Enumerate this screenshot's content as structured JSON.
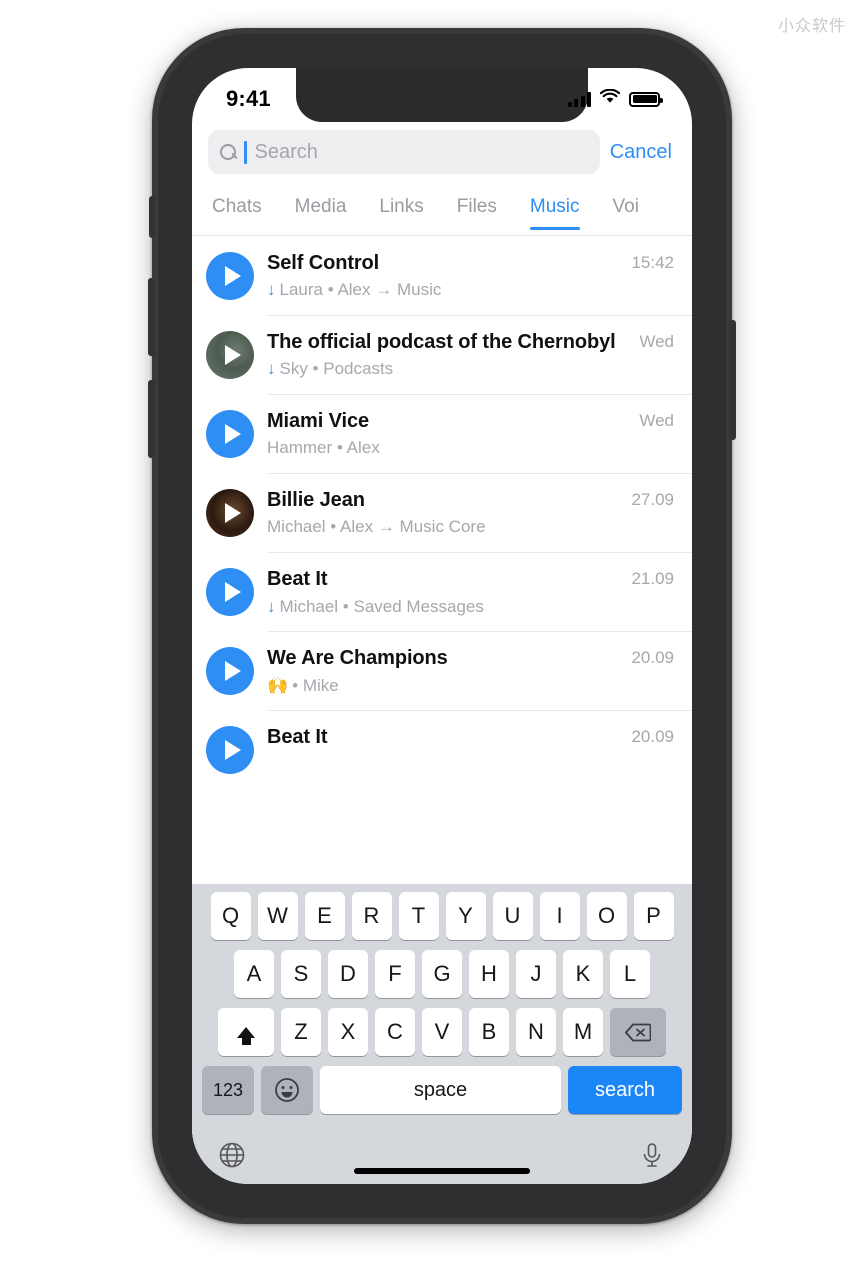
{
  "watermark": "小众软件",
  "status_bar": {
    "time": "9:41",
    "signal_icon": "signal-bars-icon",
    "wifi_icon": "wifi-icon",
    "battery_icon": "battery-full-icon"
  },
  "search": {
    "placeholder": "Search",
    "value": "",
    "icon": "search-icon",
    "cancel_label": "Cancel"
  },
  "tabs": [
    {
      "label": "Chats",
      "active": false
    },
    {
      "label": "Media",
      "active": false
    },
    {
      "label": "Links",
      "active": false
    },
    {
      "label": "Files",
      "active": false
    },
    {
      "label": "Music",
      "active": true
    },
    {
      "label": "Voi",
      "active": false
    }
  ],
  "list": [
    {
      "thumb": "play-button-blue",
      "title": "Self Control",
      "downloaded": true,
      "download_icon": "download-arrow-icon",
      "emoji": "",
      "subtitle": "Laura • Alex → Music",
      "date": "15:42"
    },
    {
      "thumb": "podcast-artwork-green",
      "title": "The official podcast of the Chernobyl",
      "downloaded": true,
      "download_icon": "download-arrow-icon",
      "emoji": "",
      "subtitle": "Sky • Podcasts",
      "date": "Wed"
    },
    {
      "thumb": "play-button-blue",
      "title": "Miami Vice",
      "downloaded": false,
      "download_icon": "",
      "emoji": "",
      "subtitle": "Hammer • Alex",
      "date": "Wed"
    },
    {
      "thumb": "album-artwork-brown",
      "title": "Billie Jean",
      "downloaded": false,
      "download_icon": "",
      "emoji": "",
      "subtitle": "Michael • Alex → Music Core",
      "date": "27.09"
    },
    {
      "thumb": "play-button-blue",
      "title": "Beat It",
      "downloaded": true,
      "download_icon": "download-arrow-icon",
      "emoji": "",
      "subtitle": "Michael • Saved Messages",
      "date": "21.09"
    },
    {
      "thumb": "play-button-blue",
      "title": "We Are Champions",
      "downloaded": false,
      "download_icon": "",
      "emoji": "🙌",
      "subtitle": "• Mike",
      "date": "20.09"
    },
    {
      "thumb": "play-button-blue",
      "title": "Beat It",
      "downloaded": false,
      "download_icon": "",
      "emoji": "",
      "subtitle": "",
      "date": "20.09"
    }
  ],
  "keyboard": {
    "row1": [
      "Q",
      "W",
      "E",
      "R",
      "T",
      "Y",
      "U",
      "I",
      "O",
      "P"
    ],
    "row2": [
      "A",
      "S",
      "D",
      "F",
      "G",
      "H",
      "J",
      "K",
      "L"
    ],
    "row3": [
      "Z",
      "X",
      "C",
      "V",
      "B",
      "N",
      "M"
    ],
    "shift_icon": "shift-icon",
    "backspace_icon": "backspace-icon",
    "numbers_label": "123",
    "emoji_icon": "emoji-smiley-icon",
    "space_label": "space",
    "search_label": "search",
    "globe_icon": "globe-icon",
    "mic_icon": "microphone-icon"
  },
  "colors": {
    "accent": "#2f8ef4",
    "key_blue": "#1b87f7",
    "muted_text": "#a7a7ad",
    "frame": "#3a3a3c"
  }
}
